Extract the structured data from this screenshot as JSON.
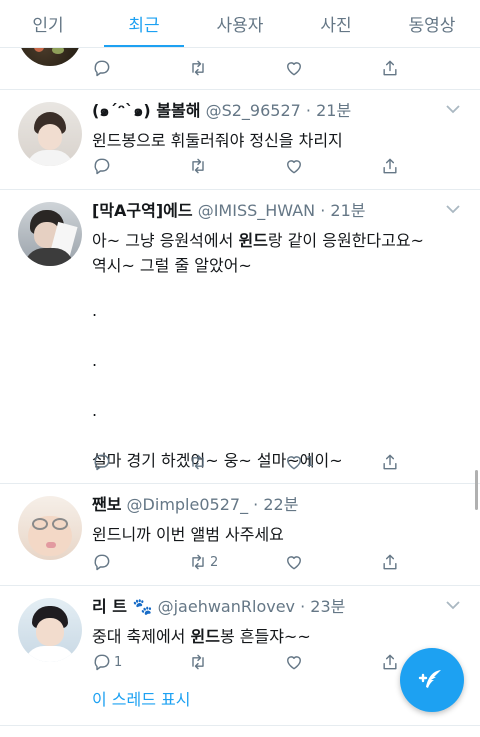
{
  "tabs": [
    "인기",
    "최근",
    "사용자",
    "사진",
    "동영상"
  ],
  "active_tab_index": 1,
  "colors": {
    "accent": "#1da1f2",
    "meta": "#657786",
    "text": "#14171a"
  },
  "tweets": [
    {
      "id": "t0",
      "actions": {
        "reply": "",
        "retweet": "",
        "like": ""
      }
    },
    {
      "id": "t1",
      "name": "(๑´ᵔ`๑) 볼볼해",
      "handle": "@S2_96527",
      "time": "21분",
      "text_lines": [
        [
          "",
          "윈드봉으로 휘둘러줘야 정신을 차리지"
        ]
      ],
      "actions": {
        "reply": "",
        "retweet": "",
        "like": ""
      }
    },
    {
      "id": "t2",
      "name": "[막A구역]에드",
      "handle": "@IMISS_HWAN",
      "time": "21분",
      "line1_pre": "아~ 그냥 응원석에서 ",
      "line1_bold": "윈드",
      "line1_post": "랑 같이 응원한다고요~",
      "line2": "역시~ 그럴 줄 알았어~",
      "dots": [
        ".",
        ".",
        "."
      ],
      "line3": "설마 경기 하겠어~ 웅~ 설마~에이~",
      "actions": {
        "reply": "",
        "retweet": "",
        "like": "1"
      }
    },
    {
      "id": "t3",
      "name": "짼보",
      "handle": "@Dimple0527_",
      "time": "22분",
      "line1": "윈드니까 이번 앨범 사주세요",
      "actions": {
        "reply": "",
        "retweet": "2",
        "like": ""
      }
    },
    {
      "id": "t4",
      "name": "리 트 🐾",
      "handle": "@jaehwanRlovev",
      "time": "23분",
      "line1_pre": "중대 축제에서 ",
      "line1_bold": "윈드",
      "line1_post": "봉 흔들쟈~~",
      "thread_link": "이 스레드 표시",
      "actions": {
        "reply": "1",
        "retweet": "",
        "like": ""
      }
    }
  ]
}
